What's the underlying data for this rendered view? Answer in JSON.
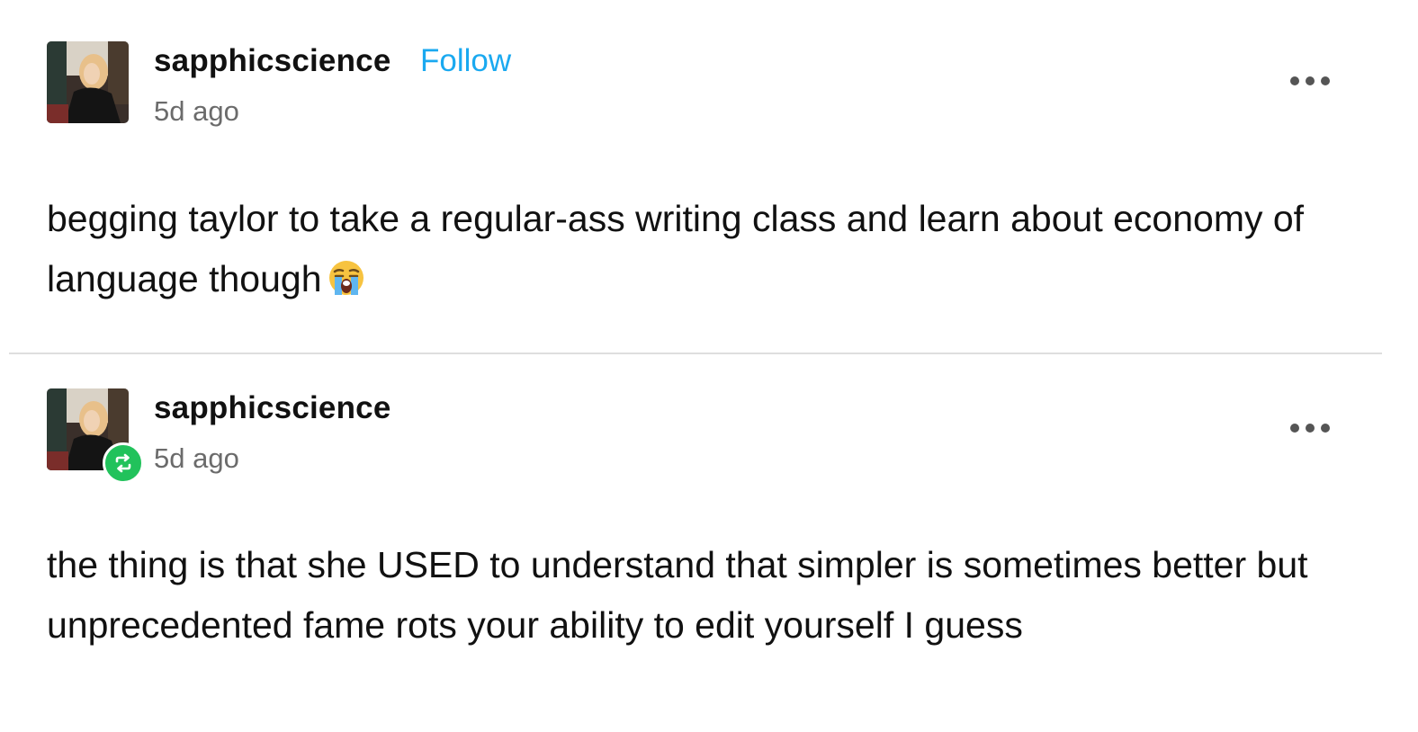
{
  "posts": [
    {
      "username": "sapphicscience",
      "follow_label": "Follow",
      "timestamp": "5d ago",
      "text": "begging taylor to take a regular-ass writing class and learn about economy of language though",
      "emoji": "loudly-crying-face"
    },
    {
      "username": "sapphicscience",
      "timestamp": "5d ago",
      "badge": "reblog-icon",
      "text": "the thing is that she USED to understand that simpler is sometimes better but unprecedented fame rots your ability to edit yourself I guess"
    }
  ],
  "colors": {
    "follow": "#1aa9f0",
    "reblog_badge": "#21c25b",
    "timestamp": "#6b6b6b",
    "divider": "#dedede"
  },
  "icons": {
    "menu": "more-options-icon",
    "reblog": "reblog-icon"
  }
}
